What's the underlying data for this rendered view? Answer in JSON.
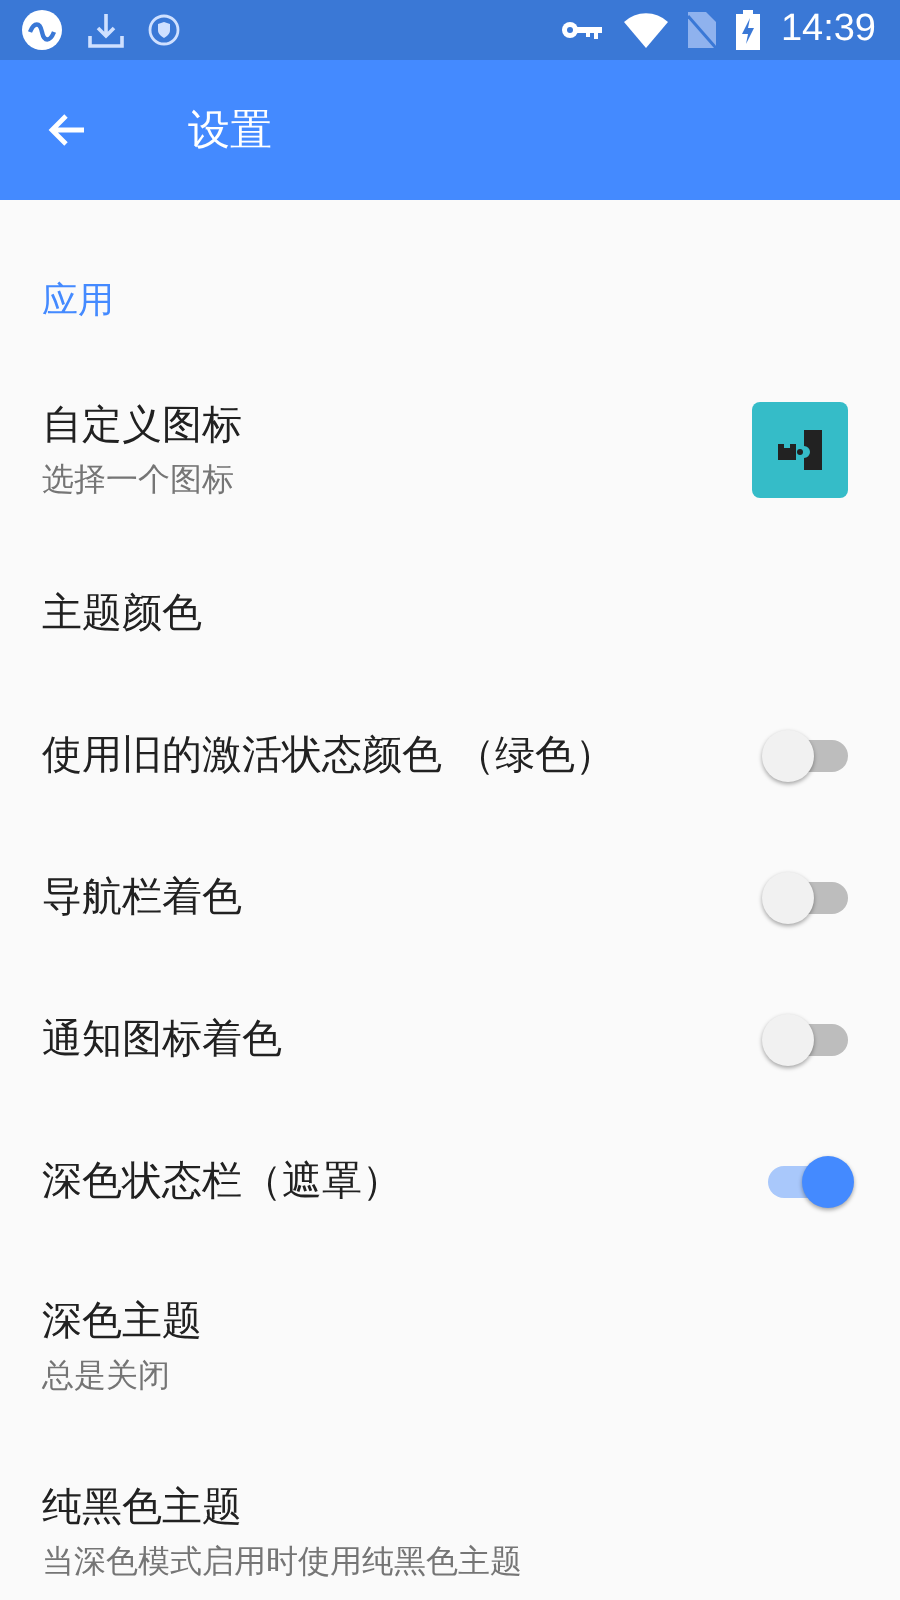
{
  "status_bar": {
    "time": "14:39"
  },
  "toolbar": {
    "title": "设置"
  },
  "section": {
    "header": "应用",
    "items": [
      {
        "kind": "icon",
        "title": "自定义图标",
        "subtitle": "选择一个图标"
      },
      {
        "kind": "plain",
        "title": "主题颜色"
      },
      {
        "kind": "switch",
        "title": "使用旧的激活状态颜色 （绿色）",
        "on": false
      },
      {
        "kind": "switch",
        "title": "导航栏着色",
        "on": false
      },
      {
        "kind": "switch",
        "title": "通知图标着色",
        "on": false
      },
      {
        "kind": "switch",
        "title": "深色状态栏（遮罩）",
        "on": true
      },
      {
        "kind": "plain",
        "title": "深色主题",
        "subtitle": "总是关闭"
      },
      {
        "kind": "plain",
        "title": "纯黑色主题",
        "subtitle": "当深色模式启用时使用纯黑色主题"
      }
    ]
  }
}
